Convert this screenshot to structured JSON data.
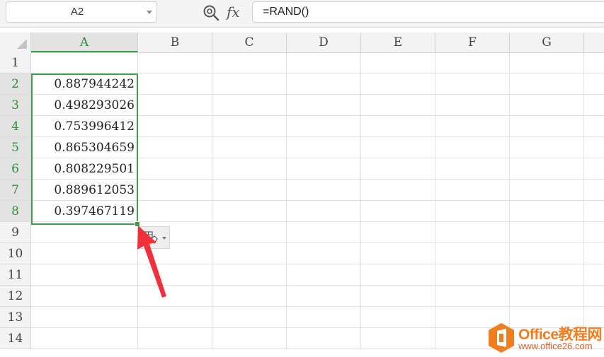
{
  "formula_bar": {
    "name_box": "A2",
    "fx_label": "fx",
    "formula": "=RAND()"
  },
  "columns": [
    "A",
    "B",
    "C",
    "D",
    "E",
    "F",
    "G"
  ],
  "rows": [
    "1",
    "2",
    "3",
    "4",
    "5",
    "6",
    "7",
    "8",
    "9",
    "10",
    "11",
    "12",
    "13",
    "14"
  ],
  "column_a_values": [
    "",
    "0.887944242",
    "0.498293026",
    "0.753996412",
    "0.865304659",
    "0.808229501",
    "0.889612053",
    "0.397467119",
    "",
    "",
    "",
    "",
    "",
    ""
  ],
  "selection": {
    "range": "A2:A8",
    "color": "#3f9f4a"
  },
  "watermark": {
    "title": "Office教程网",
    "url": "www.office26.com"
  },
  "icons": {
    "zoom": "formula-zoom-icon",
    "paste_options": "paste-options-icon",
    "annotation_arrow": "red-arrow"
  },
  "colors": {
    "accent": "#3f9f4a",
    "arrow": "#f0303a",
    "brand": "#f07d1e"
  }
}
